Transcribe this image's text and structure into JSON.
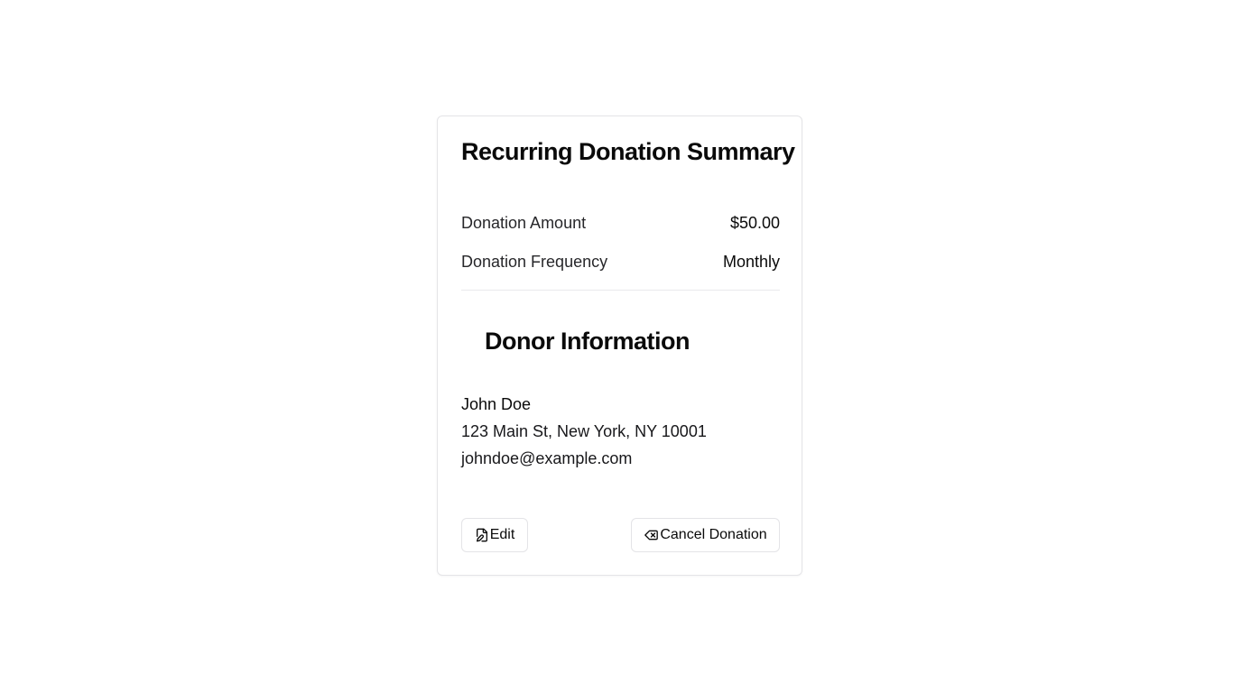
{
  "summary": {
    "title": "Recurring Donation Summary",
    "amount_label": "Donation Amount",
    "amount_value": "$50.00",
    "frequency_label": "Donation Frequency",
    "frequency_value": "Monthly"
  },
  "donor": {
    "section_title": "Donor Information",
    "name": "John Doe",
    "address": "123 Main St, New York, NY 10001",
    "email": "johndoe@example.com"
  },
  "actions": {
    "edit_label": "Edit",
    "edit_icon": "file-pen-icon",
    "cancel_label": "Cancel Donation",
    "cancel_icon": "delete-backspace-icon"
  },
  "colors": {
    "text": "#0a0a0a",
    "border": "#e4e4e7",
    "background": "#ffffff"
  }
}
